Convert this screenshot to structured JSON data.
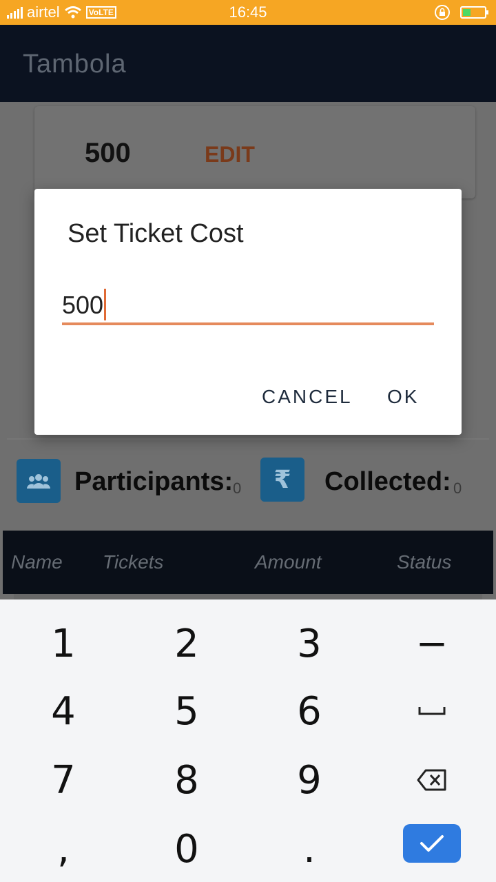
{
  "status_bar": {
    "carrier": "airtel",
    "network_badge": "VoLTE",
    "time": "16:45",
    "icons": [
      "signal-icon",
      "wifi-icon",
      "rotation-lock-icon",
      "battery-charging-icon"
    ],
    "battery_level": 0.35
  },
  "app_bar": {
    "title": "Tambola"
  },
  "cost_card": {
    "value": "500",
    "edit_label": "EDIT"
  },
  "stats": {
    "participants": {
      "label": "Participants:",
      "count": "0",
      "icon": "people-icon"
    },
    "collected": {
      "label": "Collected:",
      "count": "0",
      "icon": "rupee-icon"
    }
  },
  "table": {
    "columns": [
      "Name",
      "Tickets",
      "Amount",
      "Status"
    ]
  },
  "dialog": {
    "title": "Set Ticket Cost",
    "input_value": "500",
    "cancel_label": "CANCEL",
    "ok_label": "OK"
  },
  "keyboard": {
    "rows": [
      [
        "1",
        "2",
        "3",
        "−"
      ],
      [
        "4",
        "5",
        "6",
        "␣"
      ],
      [
        "7",
        "8",
        "9",
        "⌫"
      ],
      [
        ",",
        "0",
        ".",
        "✓"
      ]
    ]
  },
  "colors": {
    "status_bar": "#f6a623",
    "app_bar": "#0b1220",
    "accent": "#e58a5c",
    "enter_key": "#2f7be0"
  }
}
